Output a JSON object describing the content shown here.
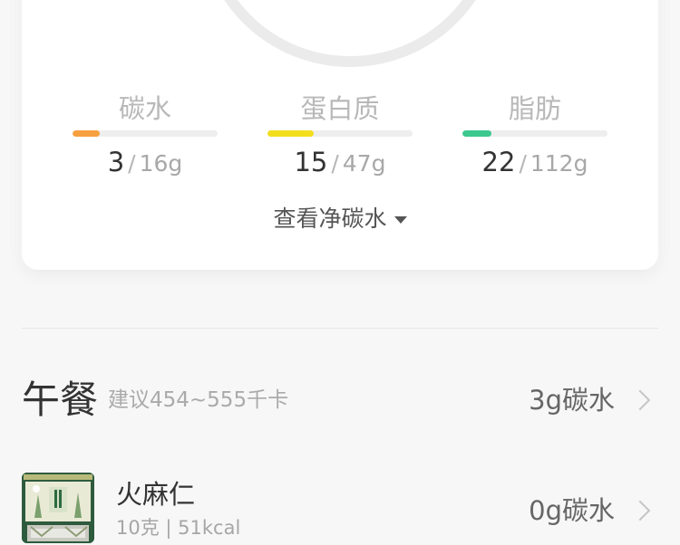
{
  "macros": [
    {
      "label": "碳水",
      "current": "3",
      "separator": "/",
      "goal": "16g",
      "progress": 0.19,
      "color": "#f7a03f"
    },
    {
      "label": "蛋白质",
      "current": "15",
      "separator": "/",
      "goal": "47g",
      "progress": 0.32,
      "color": "#f2de1c"
    },
    {
      "label": "脂肪",
      "current": "22",
      "separator": "/",
      "goal": "112g",
      "progress": 0.2,
      "color": "#3cc88e"
    }
  ],
  "net_carb_toggle": {
    "label": "查看净碳水",
    "icon": "caret-down-icon"
  },
  "lunch": {
    "title": "午餐",
    "suggestion": "建议454~555千卡",
    "carb": "3g碳水",
    "items": [
      {
        "name": "火麻仁",
        "meta": "10克 | 51kcal",
        "carb": "0g碳水",
        "thumb_icon": "hemp-seed-package-thumbnail"
      }
    ]
  }
}
